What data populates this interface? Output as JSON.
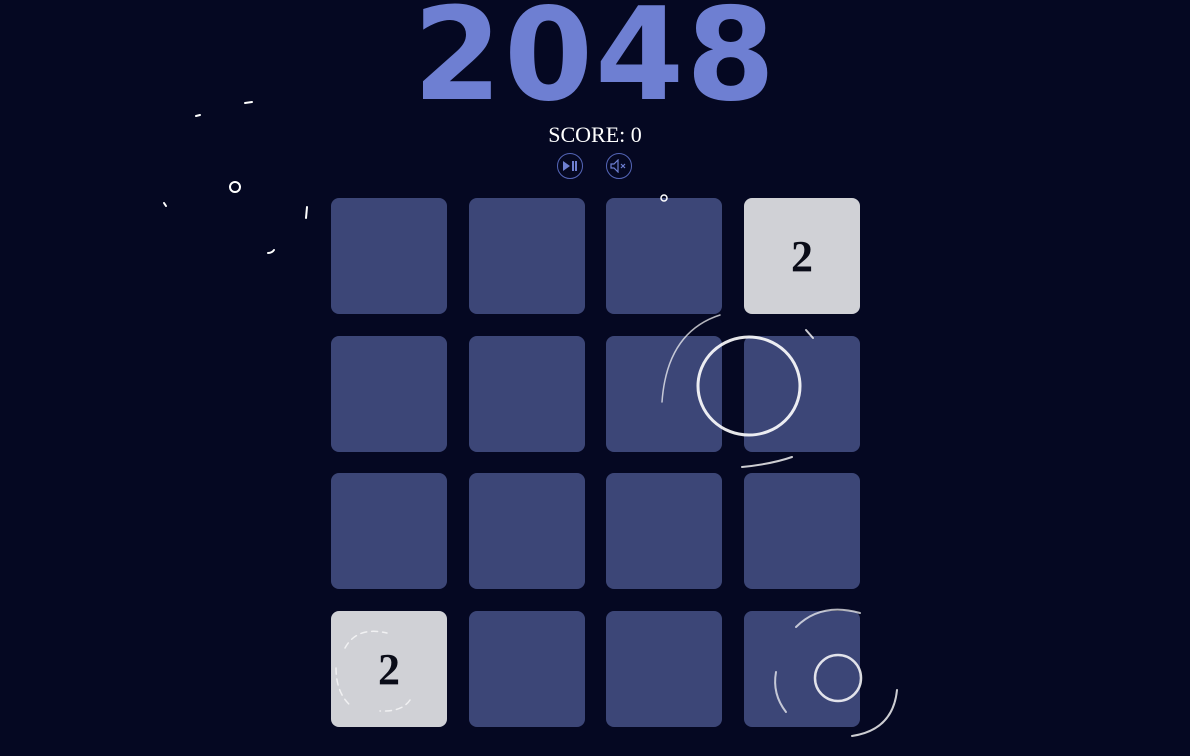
{
  "game": {
    "title": "2048",
    "score_label": "SCORE:",
    "score_value": "0",
    "controls": [
      {
        "name": "play-pause",
        "icon": "play-pause-icon"
      },
      {
        "name": "mute",
        "icon": "speaker-muted-icon"
      }
    ],
    "board": [
      [
        "",
        "",
        "",
        "2"
      ],
      [
        "",
        "",
        "",
        ""
      ],
      [
        "",
        "",
        "",
        ""
      ],
      [
        "2",
        "",
        "",
        ""
      ]
    ]
  },
  "colors": {
    "background": "#050822",
    "title": "#6e7fd2",
    "empty_tile": "#3c4677",
    "tile_2": "#d0d1d6",
    "control_stroke": "#5566b8"
  }
}
